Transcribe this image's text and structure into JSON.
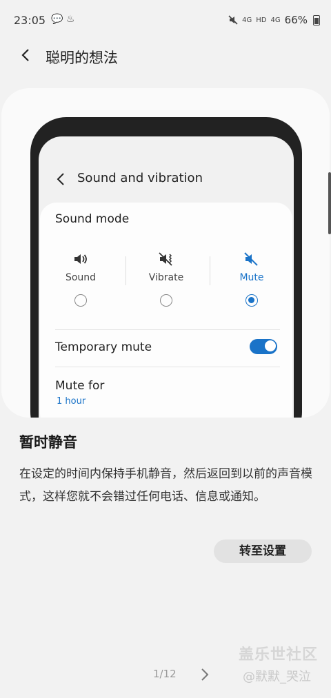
{
  "status_bar": {
    "time": "23:05",
    "left_icons": [
      "wechat-icon",
      "notification-icon"
    ],
    "right_icons": [
      "mute-icon",
      "signal-4g-icon",
      "hd-icon",
      "signal-4g-icon"
    ],
    "net1": "4G",
    "hd": "HD",
    "net2": "4G",
    "battery": "66%"
  },
  "header": {
    "back_icon": "back-arrow-icon",
    "title": "聪明的想法"
  },
  "illustration": {
    "screen_title": "Sound and vibration",
    "sound_mode_title": "Sound mode",
    "modes": [
      {
        "label": "Sound",
        "icon": "speaker-icon",
        "selected": false
      },
      {
        "label": "Vibrate",
        "icon": "vibrate-icon",
        "selected": false
      },
      {
        "label": "Mute",
        "icon": "mute-icon",
        "selected": true
      }
    ],
    "temporary_mute": {
      "label": "Temporary mute",
      "on": true
    },
    "mute_for": {
      "label": "Mute for",
      "value": "1 hour"
    }
  },
  "tip": {
    "title": "暂时静音",
    "body": "在设定的时间内保持手机静音，然后返回到以前的声音模式，这样您就不会错过任何电话、信息或通知。",
    "button": "转至设置"
  },
  "pager": {
    "text": "1/12",
    "current": 1,
    "total": 12
  },
  "watermark": {
    "line1": "盖乐世社区",
    "line2": "@默默_哭泣"
  },
  "colors": {
    "accent": "#1a73c8",
    "background": "#f2f2f2"
  }
}
